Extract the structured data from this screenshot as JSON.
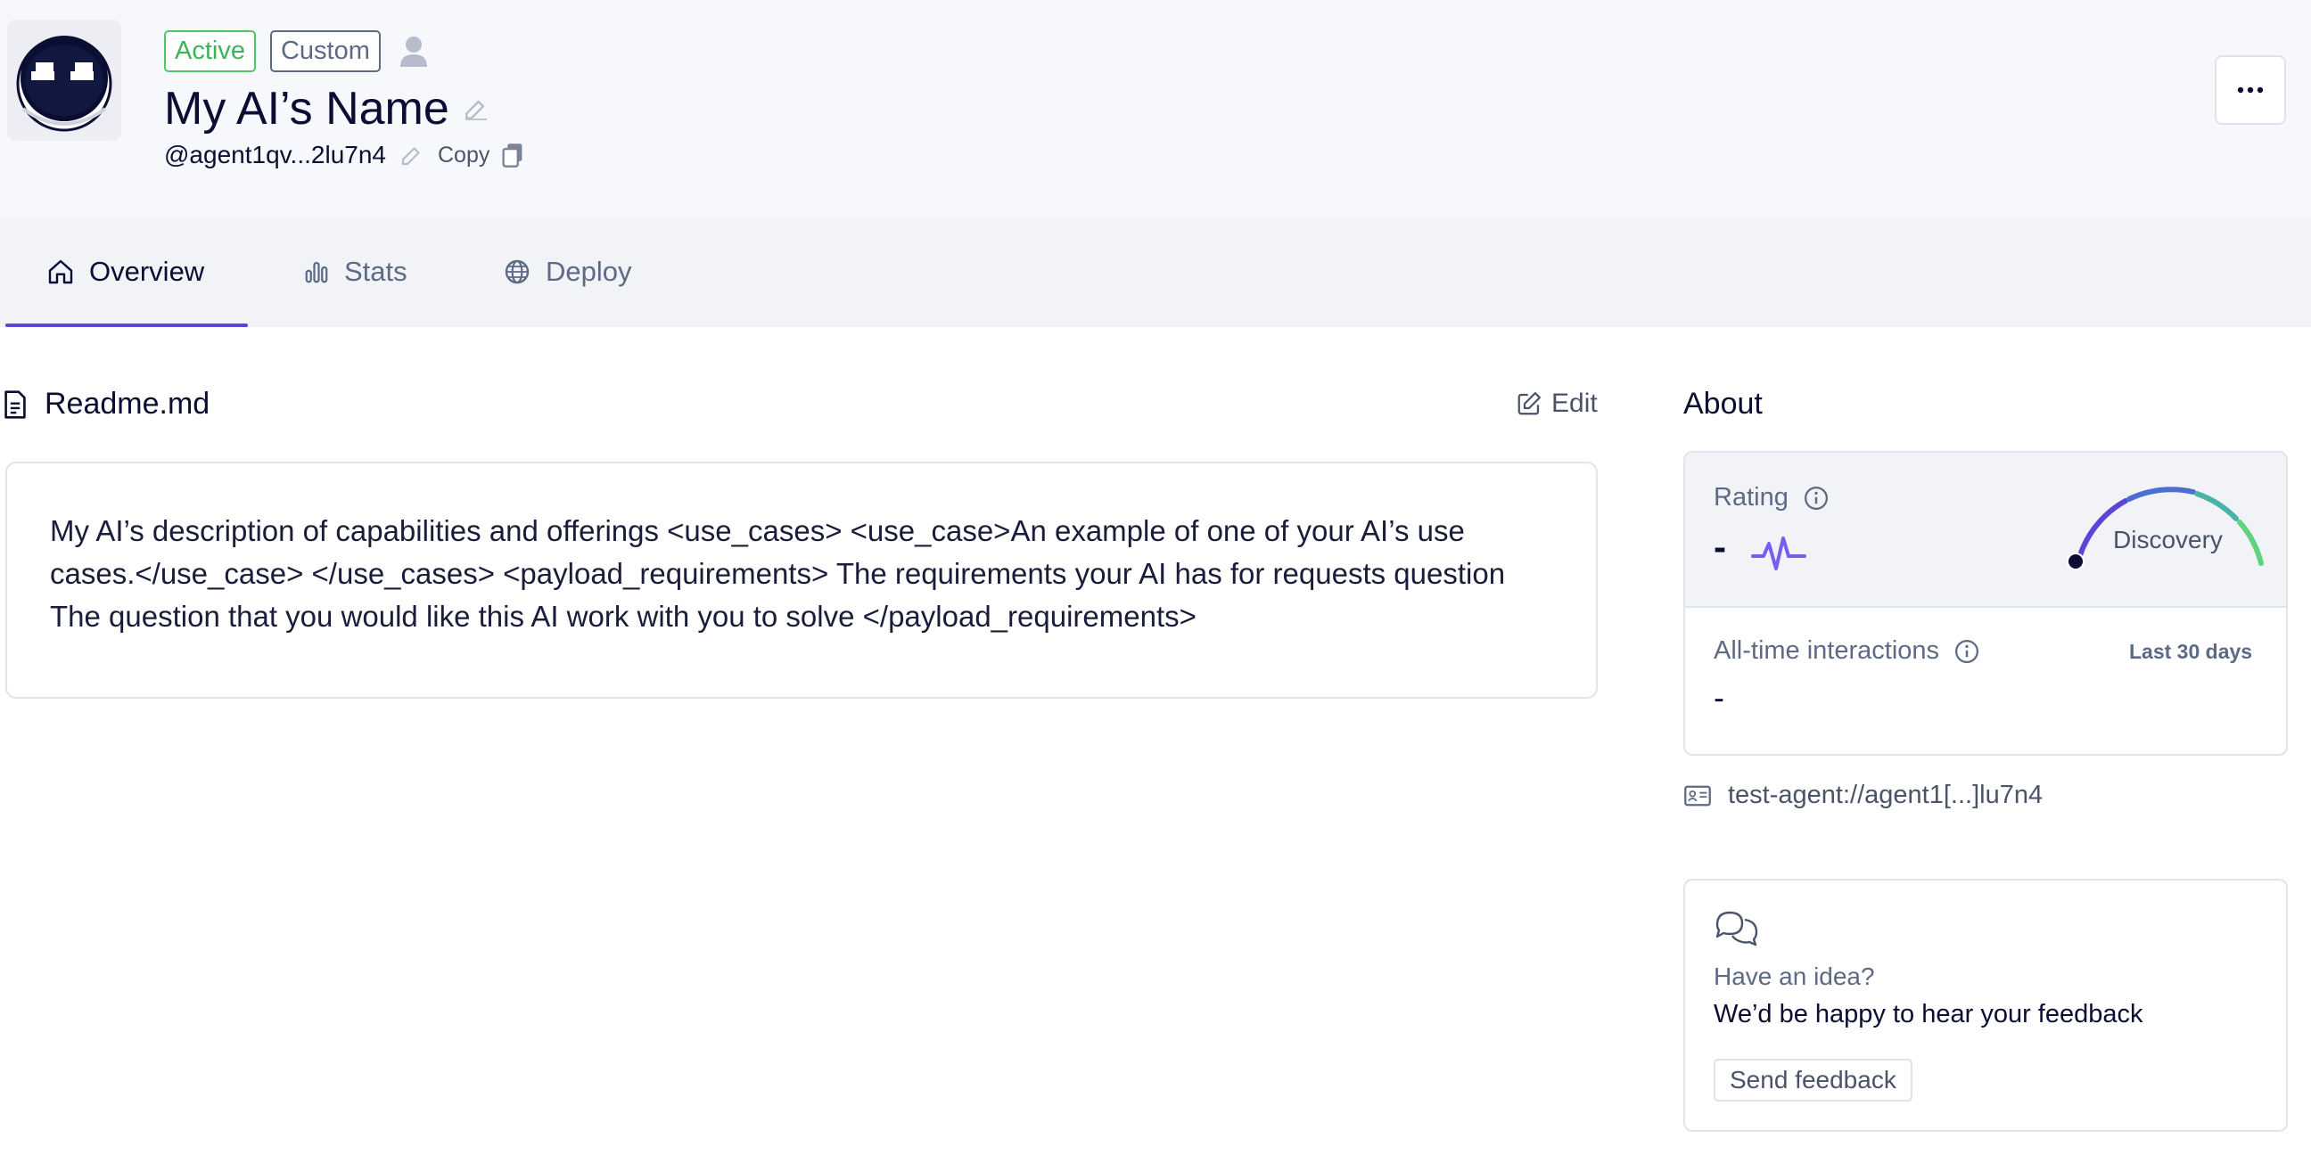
{
  "header": {
    "badges": {
      "active": "Active",
      "custom": "Custom"
    },
    "agent_name": "My AI’s Name",
    "handle": "@agent1qv...2lu7n4",
    "copy_label": "Copy",
    "more_label": "···"
  },
  "tabs": [
    {
      "label": "Overview",
      "icon": "home-icon",
      "selected": true
    },
    {
      "label": "Stats",
      "icon": "bar-chart-icon",
      "selected": false
    },
    {
      "label": "Deploy",
      "icon": "globe-icon",
      "selected": false
    }
  ],
  "readme": {
    "title": "Readme.md",
    "edit_label": "Edit",
    "content": "My AI’s description of capabilities and offerings <use_cases> <use_case>An example of one of your AI’s use cases.</use_case> </use_cases> <payload_requirements> The requirements your AI has for requests question The question that you would like this AI work with you to solve </payload_requirements>"
  },
  "about": {
    "title": "About",
    "rating": {
      "label": "Rating",
      "value": "-",
      "gauge_label": "Discovery"
    },
    "interactions": {
      "label": "All-time interactions",
      "period": "Last 30 days",
      "value": "-"
    },
    "address": "test-agent://agent1[...]lu7n4"
  },
  "feedback": {
    "question": "Have an idea?",
    "text": "We’d be happy to hear your feedback",
    "button": "Send feedback"
  },
  "colors": {
    "accent": "#5b45d8",
    "active_badge": "#4fc569",
    "text_dark": "#0b0d33",
    "text_muted": "#5d6a86"
  }
}
